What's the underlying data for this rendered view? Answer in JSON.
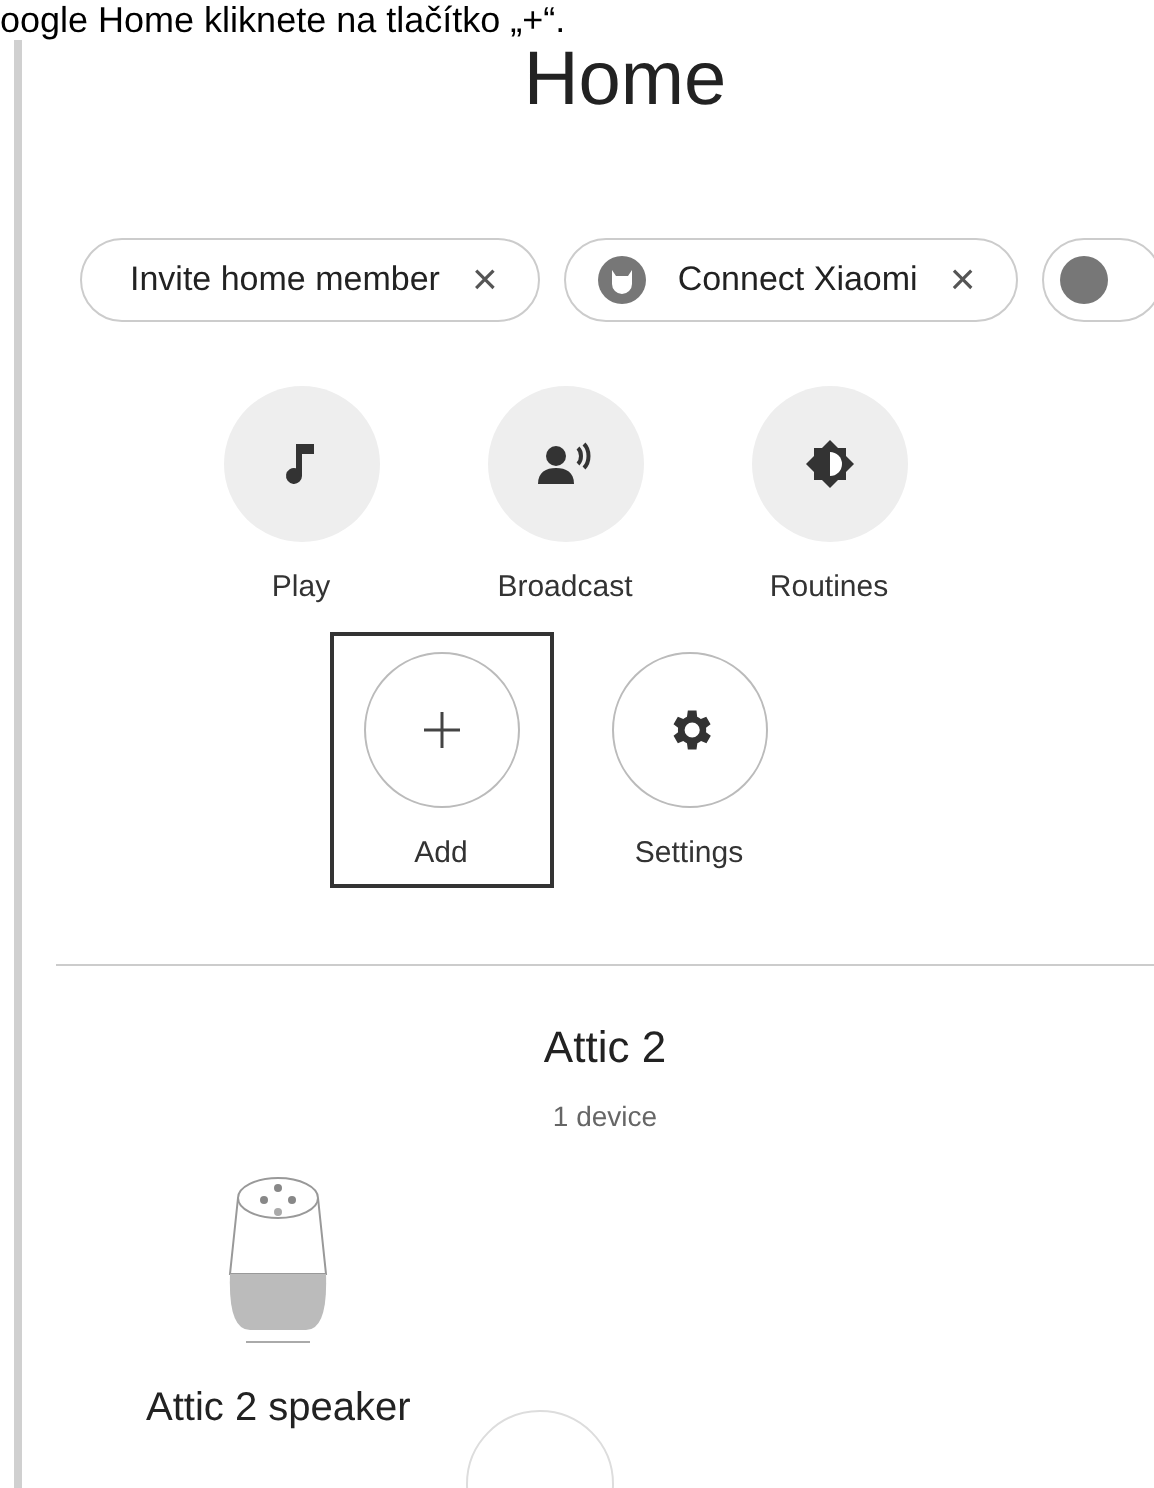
{
  "caption": "oogle Home kliknete na tlačítko „+“.",
  "title": "Home",
  "chips": [
    {
      "kind": "plain",
      "label": "Invite home member",
      "close": "×"
    },
    {
      "kind": "brand",
      "label": "Connect Xiaomi",
      "close": "×"
    },
    {
      "kind": "cut"
    }
  ],
  "actions": [
    {
      "kind": "music",
      "label": "Play",
      "outlined": false,
      "highlighted": false
    },
    {
      "kind": "broadcast",
      "label": "Broadcast",
      "outlined": false,
      "highlighted": false
    },
    {
      "kind": "routines",
      "label": "Routines",
      "outlined": false,
      "highlighted": false
    },
    {
      "kind": "add",
      "label": "Add",
      "outlined": true,
      "highlighted": true
    },
    {
      "kind": "settings",
      "label": "Settings",
      "outlined": true,
      "highlighted": false
    }
  ],
  "room": {
    "name": "Attic 2",
    "count": "1 device",
    "devices": [
      {
        "kind": "speaker",
        "name": "Attic 2 speaker"
      }
    ]
  }
}
